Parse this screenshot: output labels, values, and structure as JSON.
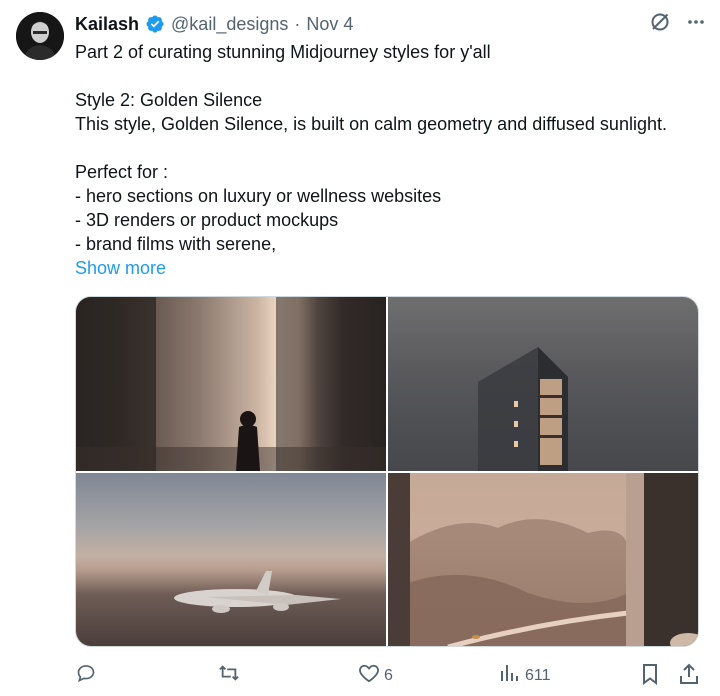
{
  "author": {
    "name": "Kailash",
    "handle": "@kail_designs",
    "separator": "·",
    "date": "Nov 4"
  },
  "tweet": {
    "lines": [
      "Part 2 of curating stunning Midjourney styles for y'all",
      "",
      "Style 2: Golden Silence",
      "This style, Golden Silence, is built on calm geometry and diffused sunlight.",
      "",
      "Perfect for :",
      "- hero sections on luxury or wellness websites",
      "- 3D renders or product mockups",
      "- brand films with serene,"
    ],
    "show_more": "Show more"
  },
  "actions": {
    "replies": "",
    "retweets": "",
    "likes": "6",
    "views": "611"
  },
  "colors": {
    "link": "#1d9bf0",
    "verified": "#1d9bf0",
    "secondary_text": "#536471"
  },
  "icons": [
    "verified-badge-icon",
    "grok-icon",
    "more-icon",
    "reply-icon",
    "retweet-icon",
    "like-icon",
    "views-icon",
    "bookmark-icon",
    "share-icon"
  ]
}
